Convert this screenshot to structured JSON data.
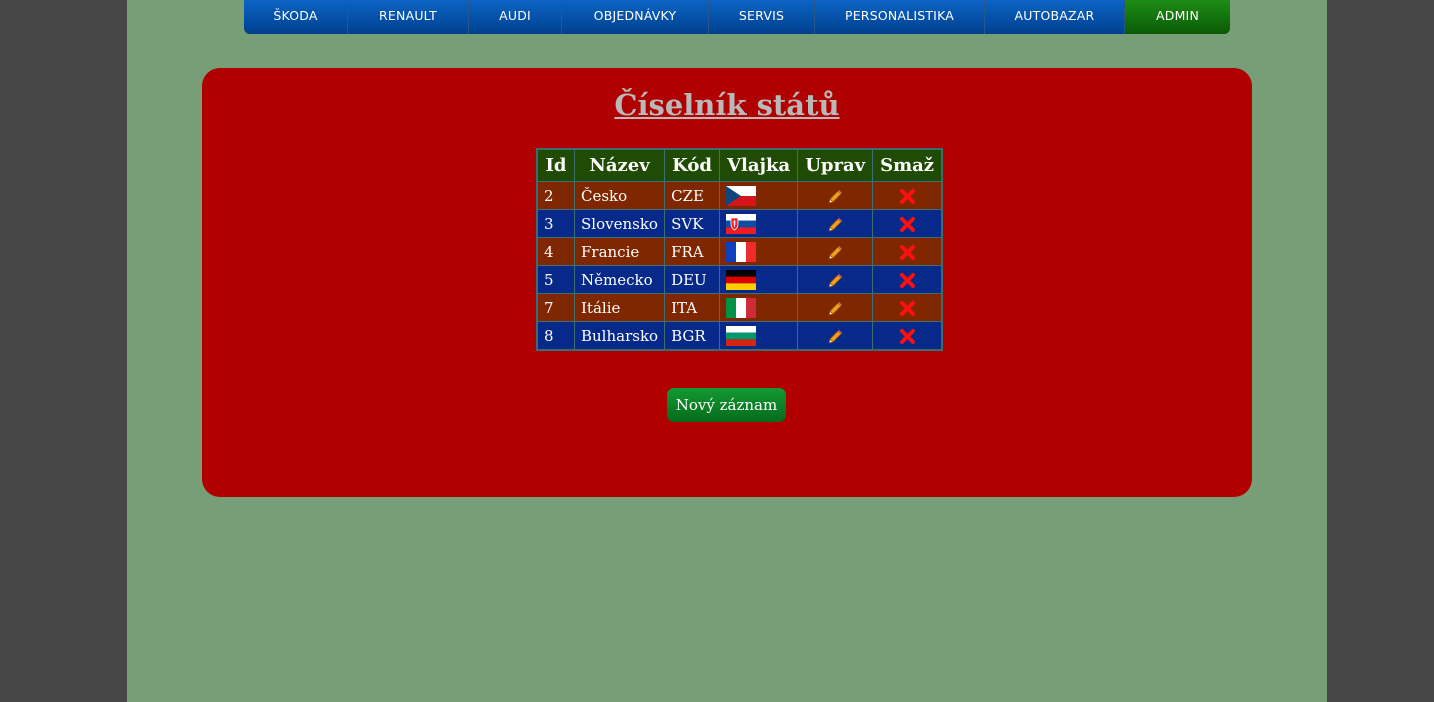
{
  "nav": {
    "items": [
      {
        "label": "ŠKODA",
        "active": false
      },
      {
        "label": "RENAULT",
        "active": false
      },
      {
        "label": "AUDI",
        "active": false
      },
      {
        "label": "OBJEDNÁVKY",
        "active": false
      },
      {
        "label": "SERVIS",
        "active": false
      },
      {
        "label": "PERSONALISTIKA",
        "active": false
      },
      {
        "label": "AUTOBAZAR",
        "active": false
      },
      {
        "label": "ADMIN",
        "active": true
      }
    ]
  },
  "main": {
    "title": "Číselník států",
    "table": {
      "headers": [
        "Id",
        "Název",
        "Kód",
        "Vlajka",
        "Uprav",
        "Smaž"
      ],
      "rows": [
        {
          "id": "2",
          "name": "Česko",
          "code": "CZE",
          "flag": "czech-flag"
        },
        {
          "id": "3",
          "name": "Slovensko",
          "code": "SVK",
          "flag": "slovak-flag"
        },
        {
          "id": "4",
          "name": "Francie",
          "code": "FRA",
          "flag": "french-flag"
        },
        {
          "id": "5",
          "name": "Německo",
          "code": "DEU",
          "flag": "german-flag"
        },
        {
          "id": "7",
          "name": "Itálie",
          "code": "ITA",
          "flag": "italian-flag"
        },
        {
          "id": "8",
          "name": "Bulharsko",
          "code": "BGR",
          "flag": "bulgarian-flag"
        }
      ],
      "edit_icon": "pencil-icon",
      "delete_icon": "red-x-icon"
    },
    "new_button_label": "Nový záznam"
  },
  "colors": {
    "background_outer": "#474747",
    "page_background": "#789e77",
    "panel": "#b10000",
    "nav_blue": "#0a56b0",
    "nav_active": "#157a0f",
    "row_odd": "#7e2700",
    "row_even": "#06298a",
    "header": "#1f4b05",
    "button": "#0d8a2b"
  }
}
